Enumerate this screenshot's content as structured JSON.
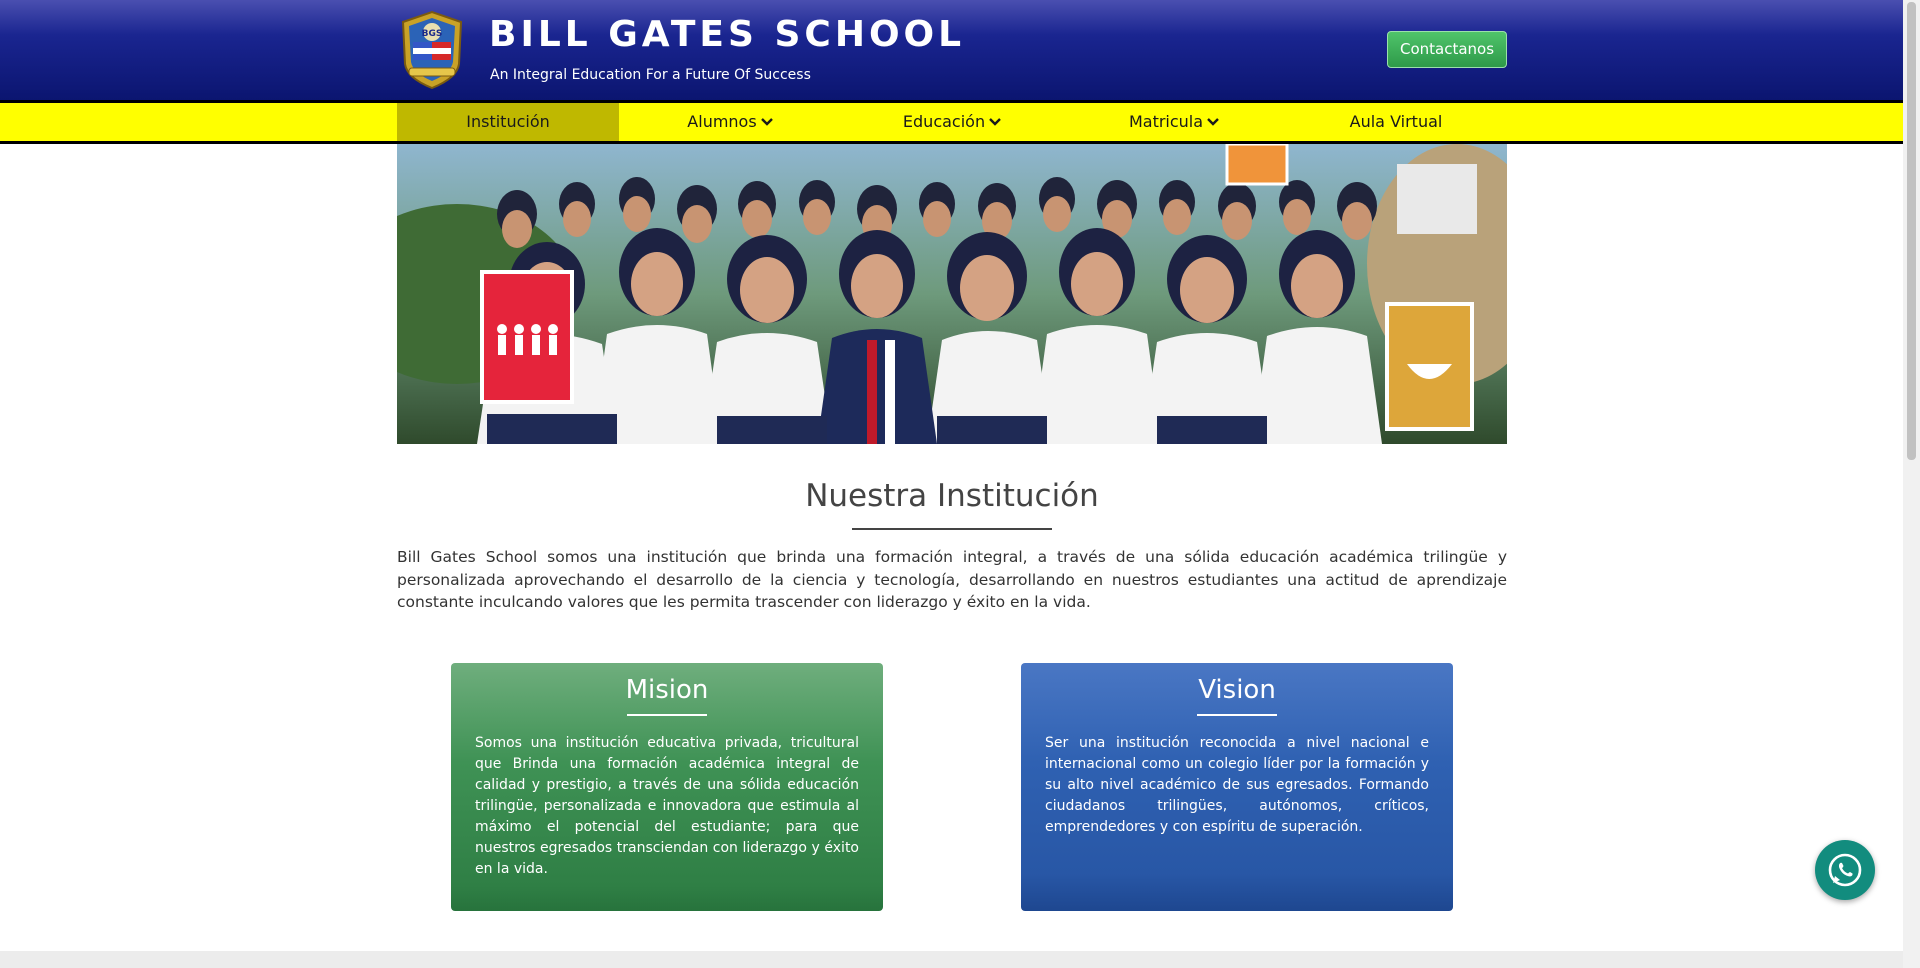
{
  "header": {
    "title": "BILL GATES SCHOOL",
    "subtitle": "An Integral Education For a Future Of Success",
    "contact_label": "Contactanos"
  },
  "nav": {
    "items": [
      {
        "label": "Institución",
        "active": true,
        "dropdown": false
      },
      {
        "label": "Alumnos",
        "active": false,
        "dropdown": true
      },
      {
        "label": "Educación",
        "active": false,
        "dropdown": true
      },
      {
        "label": "Matricula",
        "active": false,
        "dropdown": true
      },
      {
        "label": "Aula Virtual",
        "active": false,
        "dropdown": false
      }
    ]
  },
  "main": {
    "section_title": "Nuestra Institución",
    "intro": "Bill Gates School somos una institución que brinda una formación integral, a través de una sólida educación académica trilingüe y personalizada aprovechando el desarrollo de la ciencia y tecnología, desarrollando en nuestros estudiantes una actitud de aprendizaje constante inculcando valores que les permita trascender con liderazgo y éxito en la vida.",
    "mision": {
      "title": "Mision",
      "text": "Somos una institución educativa privada, tricultural que Brinda una formación académica integral de calidad y prestigio, a través de una sólida educación trilingüe, personalizada e innovadora que estimula al máximo el potencial del estudiante; para que nuestros egresados transciendan con liderazgo y éxito en la vida."
    },
    "vision": {
      "title": "Vision",
      "text": "Ser una institución reconocida a nivel nacional e internacional como un colegio líder por la formación y su alto nivel académico de sus egresados. Formando ciudadanos trilingües, autónomos, críticos, emprendedores y con espíritu de superación."
    }
  },
  "colors": {
    "header_blue": "#0b1570",
    "nav_yellow": "#ffff00",
    "nav_active": "#bfb800",
    "mision_green": "#3f9255",
    "vision_blue": "#2f61b2",
    "contact_green": "#2e9a49",
    "whatsapp": "#128c7e"
  },
  "icons": {
    "logo": "school-crest-icon",
    "dropdown": "chevron-down-icon",
    "chat": "whatsapp-icon"
  }
}
